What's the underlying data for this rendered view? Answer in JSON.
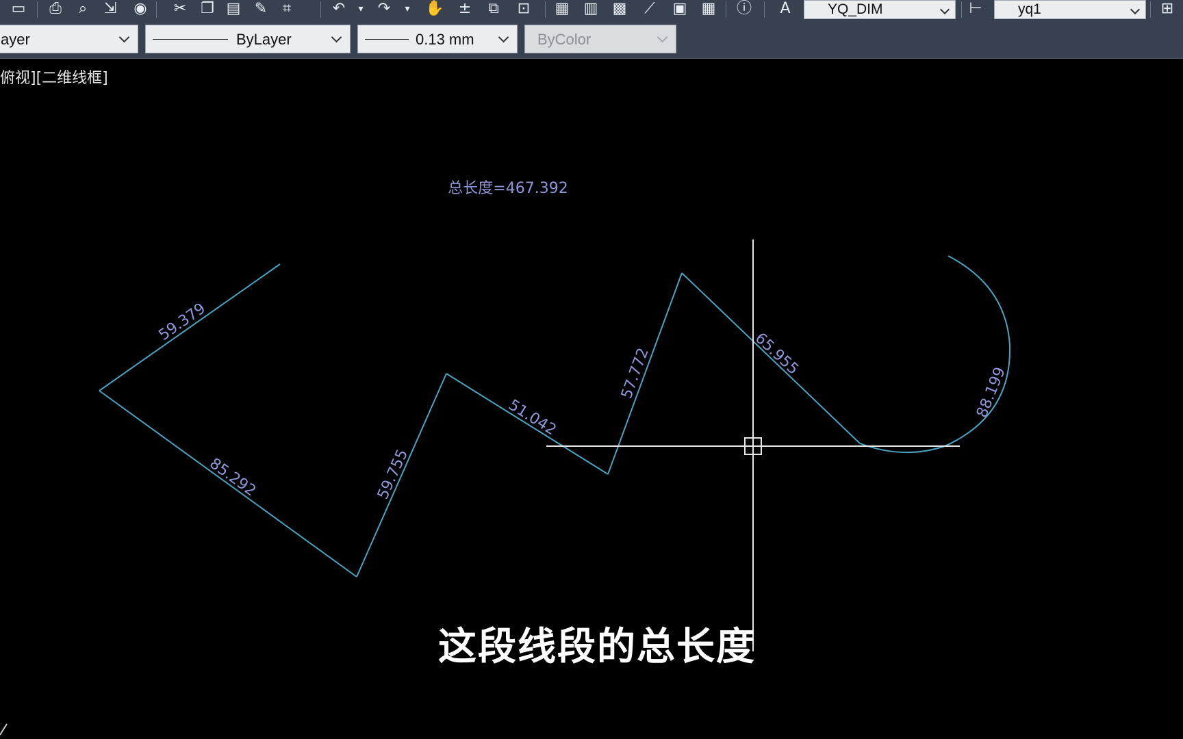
{
  "toolbar": {
    "dimstyle_value": "YQ_DIM",
    "textstyle_value": "yq1",
    "icons": [
      "save-icon",
      "print-icon",
      "print-preview-icon",
      "publish-icon",
      "3d-dwf-icon",
      "cut-icon",
      "copy-icon",
      "paste-icon",
      "match-properties-icon",
      "block-editor-icon",
      "undo-icon",
      "redo-icon",
      "pan-icon",
      "zoom-realtime-icon",
      "zoom-window-icon",
      "zoom-previous-icon",
      "properties-icon",
      "design-center-icon",
      "tool-palettes-icon",
      "sheet-set-icon",
      "markup-icon",
      "calculator-icon",
      "help-icon",
      "text-style-icon",
      "dim-style-icon",
      "table-style-icon"
    ]
  },
  "properties": {
    "layer_value": "ayer",
    "linetype_value": "ByLayer",
    "lineweight_value": "0.13 mm",
    "plotstyle_value": "ByColor"
  },
  "viewport": {
    "label": "俯视][二维线框]"
  },
  "drawing": {
    "total_label": "总长度=467.392",
    "line_color": "#4aa3c0",
    "text_color": "#8f95d6",
    "segment_lengths": [
      "59.379",
      "85.292",
      "59.755",
      "51.042",
      "57.772",
      "65.955",
      "88.199"
    ]
  },
  "subtitle": {
    "text": "这段线段的总长度"
  }
}
